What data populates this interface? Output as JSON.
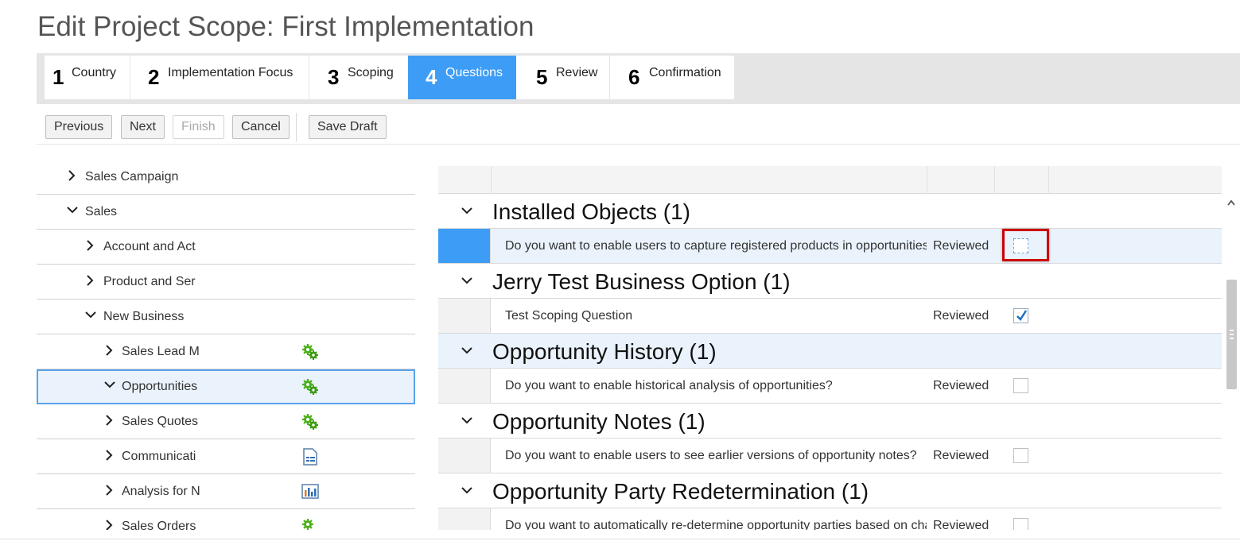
{
  "page": {
    "title": "Edit Project Scope: First Implementation"
  },
  "wizard": {
    "steps": [
      {
        "num": "1",
        "label": "Country"
      },
      {
        "num": "2",
        "label": "Implementation Focus"
      },
      {
        "num": "3",
        "label": "Scoping"
      },
      {
        "num": "4",
        "label": "Questions",
        "active": true
      },
      {
        "num": "5",
        "label": "Review"
      },
      {
        "num": "6",
        "label": "Confirmation"
      }
    ]
  },
  "toolbar": {
    "previous": "Previous",
    "next": "Next",
    "finish": "Finish",
    "cancel": "Cancel",
    "save_draft": "Save Draft"
  },
  "tree": {
    "items": [
      {
        "label": "Sales Campaign",
        "expanded": false,
        "icon": ""
      },
      {
        "label": "Sales",
        "expanded": true,
        "icon": ""
      },
      {
        "label": "Account and Act",
        "expanded": false,
        "icon": ""
      },
      {
        "label": "Product and Ser",
        "expanded": false,
        "icon": ""
      },
      {
        "label": "New Business",
        "expanded": true,
        "icon": ""
      },
      {
        "label": "Sales Lead M",
        "expanded": false,
        "icon": "gears-icon"
      },
      {
        "label": "Opportunities",
        "expanded": true,
        "icon": "gears-icon",
        "selected": true
      },
      {
        "label": "Sales Quotes",
        "expanded": false,
        "icon": "gears-icon"
      },
      {
        "label": "Communicati",
        "expanded": false,
        "icon": "document-list-icon"
      },
      {
        "label": "Analysis for N",
        "expanded": false,
        "icon": "report-chart-icon"
      },
      {
        "label": "Sales Orders",
        "expanded": false,
        "icon": "gears-icon"
      }
    ]
  },
  "grid": {
    "groups": [
      {
        "title": "Installed Objects (1)",
        "question": "Do you want to enable users to capture registered products in opportunities?",
        "status": "Reviewed",
        "checked": false
      },
      {
        "title": "Jerry Test Business Option (1)",
        "question": "Test Scoping Question",
        "status": "Reviewed",
        "checked": true
      },
      {
        "title": "Opportunity History (1)",
        "question": "Do you want to enable historical analysis of opportunities?",
        "status": "Reviewed",
        "checked": false
      },
      {
        "title": "Opportunity Notes (1)",
        "question": "Do you want to enable users to see earlier versions of opportunity notes?",
        "status": "Reviewed",
        "checked": false
      },
      {
        "title": "Opportunity Party Redetermination (1)",
        "question": "Do you want to automatically re-determine opportunity parties based on changes?",
        "status": "Reviewed",
        "checked": false
      }
    ]
  },
  "colors": {
    "accent": "#3d9df6",
    "highlight_row": "#eaf3fc",
    "annotation_red": "#cc0000",
    "gear_green": "#4caf1a"
  }
}
